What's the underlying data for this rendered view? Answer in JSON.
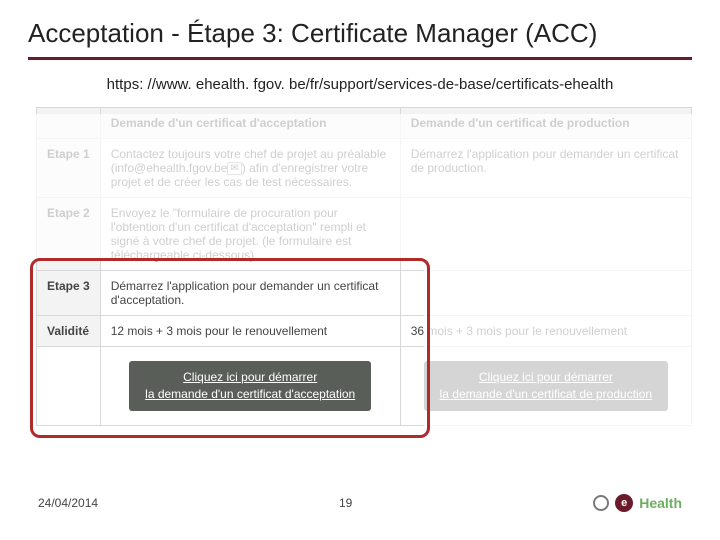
{
  "title": "Acceptation - Étape 3: Certificate Manager (ACC)",
  "url": "https: //www. ehealth. fgov. be/fr/support/services-de-base/certificats-ehealth",
  "table": {
    "header_blank": "",
    "header_acc": "Demande d'un certificat d'acceptation",
    "header_prod": "Demande d'un certificat de production",
    "rows": [
      {
        "label": "Etape 1",
        "acc_pre": "Contactez toujours votre chef de projet au préalable (",
        "acc_mail": "info@ehealth.fgov.be",
        "acc_post": ") afin d'enregistrer votre projet et de créer les cas de test nécessaires.",
        "prod": "Démarrez l'application pour demander un certificat de production."
      },
      {
        "label": "Etape 2",
        "acc": "Envoyez le \"formulaire de procuration pour l'obtention d'un certificat d'acceptation\" rempli et signé à votre chef de projet. (le formulaire est téléchargeable ci-dessous)",
        "prod": ""
      },
      {
        "label": "Etape 3",
        "acc": "Démarrez l'application pour demander un certificat d'acceptation.",
        "prod": ""
      },
      {
        "label": "Validité",
        "acc": "12 mois + 3 mois pour le renouvellement",
        "prod": "36 mois + 3 mois pour le renouvellement"
      }
    ],
    "btn_acc_line1": "Cliquez ici pour démarrer",
    "btn_acc_line2": "la demande d'un certificat d'acceptation",
    "btn_prod_line1": "Cliquez ici pour démarrer",
    "btn_prod_line2": "la demande d'un certificat de production"
  },
  "footer": {
    "date": "24/04/2014",
    "page": "19",
    "logo_e": "e",
    "logo_word": "Health"
  }
}
